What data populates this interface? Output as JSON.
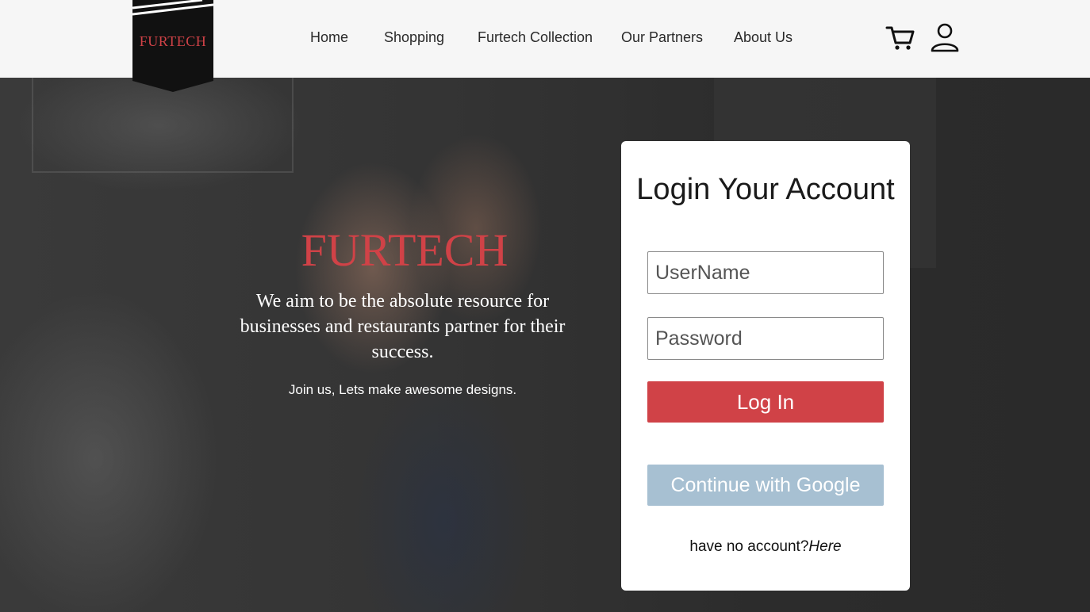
{
  "header": {
    "brand": "FURTECH",
    "nav": [
      {
        "label": "Home"
      },
      {
        "label": "Shopping"
      },
      {
        "label": "Furtech Collection"
      },
      {
        "label": "Our Partners"
      },
      {
        "label": "About Us"
      }
    ],
    "icons": {
      "cart": "cart-icon",
      "account": "user-icon"
    }
  },
  "hero": {
    "brand": "FURTECH",
    "tagline": "We aim to be the absolute resource for businesses and restaurants partner for their success.",
    "subtext": "Join us, Lets make awesome designs."
  },
  "login": {
    "title": "Login Your Account",
    "username_placeholder": "UserName",
    "password_placeholder": "Password",
    "login_button": "Log In",
    "google_button": "Continue with Google",
    "signup_prompt": "have no account?",
    "signup_link": "Here"
  },
  "colors": {
    "brand_red": "#d04247",
    "google_button": "#a7c0d2",
    "header_bg": "#f6f6f6"
  }
}
